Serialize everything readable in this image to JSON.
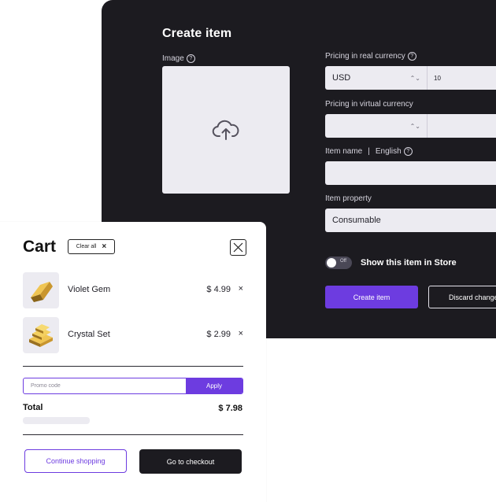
{
  "create_item": {
    "title": "Create item",
    "image_label": "Image",
    "pricing_real_label": "Pricing in real currency",
    "currency": "USD",
    "real_price": "10",
    "pricing_virtual_label": "Pricing in virtual currency",
    "virtual_currency": "",
    "virtual_price": "",
    "item_name_label": "Item name",
    "item_name_lang": "English",
    "item_name_value": "",
    "item_property_label": "Item property",
    "item_property_value": "Consumable",
    "toggle_state": "Off",
    "show_in_store_label": "Show this item in Store",
    "create_button": "Create item",
    "discard_button": "Discard changes"
  },
  "cart": {
    "title": "Cart",
    "clear_all": "Clear all",
    "items": [
      {
        "name": "Violet Gem",
        "price": "$ 4.99"
      },
      {
        "name": "Crystal Set",
        "price": "$ 2.99"
      }
    ],
    "promo_placeholder": "Promo code",
    "apply_button": "Apply",
    "total_label": "Total",
    "total_value": "$ 7.98",
    "continue_button": "Continue shopping",
    "checkout_button": "Go to checkout"
  },
  "colors": {
    "accent": "#6d3ce0",
    "panel_bg": "#1c1b20",
    "field_bg": "#ecebf1"
  }
}
